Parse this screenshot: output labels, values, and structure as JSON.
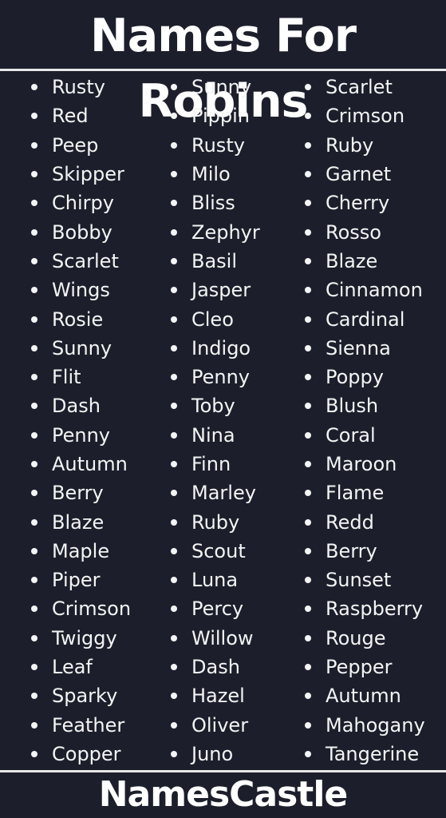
{
  "title": "Names For Robins",
  "columns": [
    [
      "Rusty",
      "Red",
      "Peep",
      "Skipper",
      "Chirpy",
      "Bobby",
      "Scarlet",
      "Wings",
      "Rosie",
      "Sunny",
      "Flit",
      "Dash",
      "Penny",
      "Autumn",
      "Berry",
      "Blaze",
      "Maple",
      "Piper",
      "Crimson",
      "Twiggy",
      "Leaf",
      "Sparky",
      "Feather",
      "Copper"
    ],
    [
      "Sunny",
      "Pippin",
      "Rusty",
      "Milo",
      "Bliss",
      "Zephyr",
      "Basil",
      "Jasper",
      "Cleo",
      "Indigo",
      "Penny",
      "Toby",
      "Nina",
      "Finn",
      "Marley",
      "Ruby",
      "Scout",
      "Luna",
      "Percy",
      "Willow",
      "Dash",
      "Hazel",
      "Oliver",
      "Juno"
    ],
    [
      "Scarlet",
      "Crimson",
      "Ruby",
      "Garnet",
      "Cherry",
      "Rosso",
      "Blaze",
      "Cinnamon",
      "Cardinal",
      "Sienna",
      "Poppy",
      "Blush",
      "Coral",
      "Maroon",
      "Flame",
      "Redd",
      "Berry",
      "Sunset",
      "Raspberry",
      "Rouge",
      "Pepper",
      "Autumn",
      "Mahogany",
      "Tangerine"
    ]
  ],
  "footer": "NamesCastle",
  "colors": {
    "background": "#1c1f2b",
    "text": "#f4f4f4",
    "rule": "#e8e8e8"
  }
}
